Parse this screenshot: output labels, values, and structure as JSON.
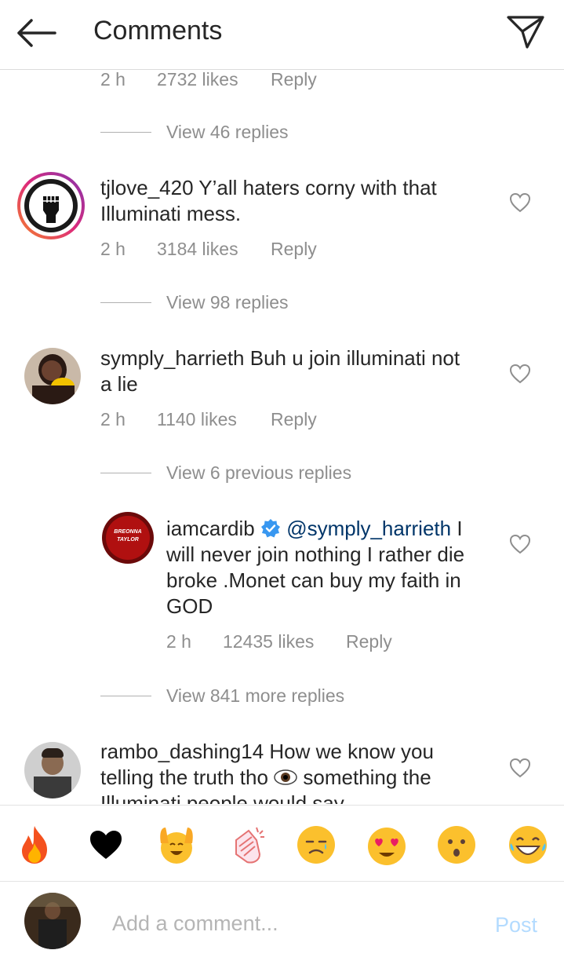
{
  "header": {
    "title": "Comments"
  },
  "comments": [
    {
      "meta": {
        "time": "2 h",
        "likes": "2732 likes",
        "reply": "Reply"
      },
      "view_replies": "View 46 replies"
    },
    {
      "username": "tjlove_420",
      "text": " Y’all haters corny with that",
      "text2": "Illuminati mess.",
      "meta": {
        "time": "2 h",
        "likes": "3184 likes",
        "reply": "Reply"
      },
      "view_replies": "View 98 replies"
    },
    {
      "username": "symply_harrieth",
      "text": " Buh u join illuminati not",
      "text2": "a lie",
      "meta": {
        "time": "2 h",
        "likes": "1140 likes",
        "reply": "Reply"
      },
      "view_replies": "View 6 previous replies"
    },
    {
      "username": "iamcardib",
      "mention": "@symply_harrieth",
      "text": " I",
      "text2": "will never join nothing I rather die",
      "text3": "broke .Monet can buy my faith in",
      "text4": "GOD",
      "avatar_text1": "BREONNA",
      "avatar_text2": "TAYLOR",
      "meta": {
        "time": "2 h",
        "likes": "12435 likes",
        "reply": "Reply"
      },
      "view_replies": "View 841 more replies"
    },
    {
      "username": "rambo_dashing14",
      "text": " How we know you",
      "text2": "telling the truth tho",
      "text2b": " something the",
      "text3": "Illuminati people would say"
    }
  ],
  "emoji_bar": [
    "fire-emoji",
    "black-heart-emoji",
    "raising-hands-emoji",
    "clapping-emoji",
    "sad-face-emoji",
    "heart-eyes-emoji",
    "surprised-emoji",
    "laughing-emoji"
  ],
  "composer": {
    "placeholder": "Add a comment...",
    "post_label": "Post"
  },
  "colors": {
    "text": "#262626",
    "muted": "#8e8e8e",
    "verified": "#3897f0",
    "post_disabled": "#b3dbff",
    "mention": "#003569"
  }
}
